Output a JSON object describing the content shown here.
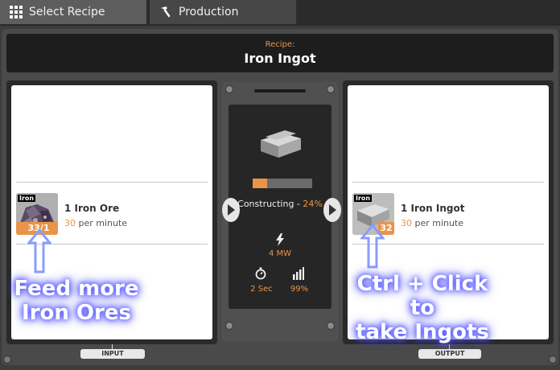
{
  "tabs": [
    {
      "label": "Select Recipe",
      "icon": "grid-icon"
    },
    {
      "label": "Production",
      "icon": "hammer-icon"
    }
  ],
  "recipe": {
    "caption": "Recipe:",
    "name": "Iron Ingot"
  },
  "input": {
    "tag": "Iron",
    "badge": "33/1",
    "name": "1 Iron Ore",
    "rate_value": "30",
    "rate_unit": "per minute",
    "label": "INPUT"
  },
  "output": {
    "tag": "Iron",
    "badge": "32",
    "name": "1 Iron Ingot",
    "rate_value": "30",
    "rate_unit": "per minute",
    "label": "OUTPUT"
  },
  "machine": {
    "status": "Constructing",
    "separator": " - ",
    "progress_text": "24%",
    "progress": 0.24,
    "power": "4 MW",
    "cycle_time": "2 Sec",
    "efficiency": "99%"
  },
  "annotations": {
    "left": [
      "Feed more",
      "Iron  Ores"
    ],
    "right": [
      "Ctrl + Click to",
      "take Ingots"
    ]
  },
  "colors": {
    "accent": "#e8954a",
    "glow": "#5a5aff"
  }
}
